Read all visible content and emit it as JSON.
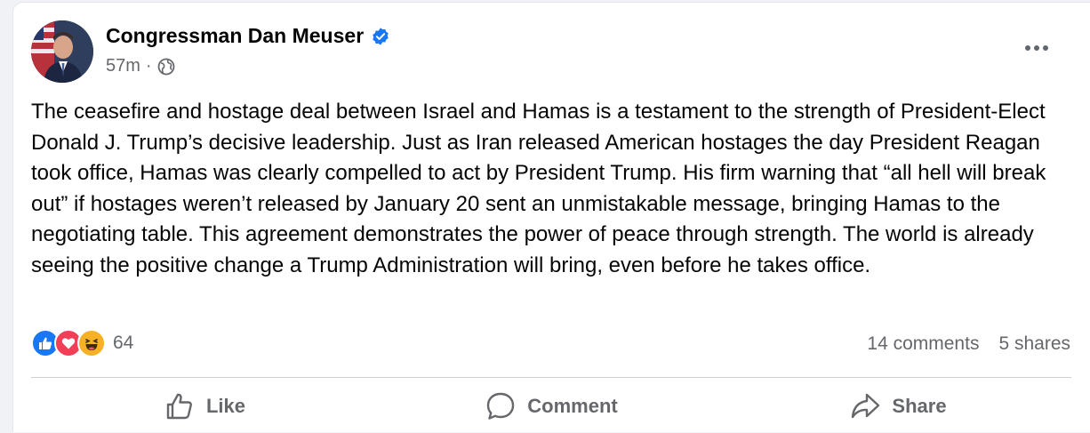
{
  "post": {
    "author": "Congressman Dan Meuser",
    "time": "57m",
    "separator": "·",
    "audience_icon": "globe-icon",
    "verified_icon": "verified-badge-icon",
    "text": "The ceasefire and hostage deal between Israel and Hamas is a testament to the strength of President-Elect Donald J. Trump’s decisive leadership. Just as Iran released American hostages the day President Reagan took office, Hamas was clearly compelled to act by President Trump. His firm warning that “all hell will break out” if hostages weren’t released by January 20 sent an unmistakable message, bringing Hamas to the negotiating table. This agreement demonstrates the power of peace through strength. The world is already seeing the positive change a Trump Administration will bring, even before he takes office."
  },
  "reactions": {
    "icons": [
      "like-icon",
      "love-icon",
      "haha-icon"
    ],
    "count": "64"
  },
  "stats": {
    "comments": "14 comments",
    "shares": "5 shares"
  },
  "actions": {
    "like": "Like",
    "comment": "Comment",
    "share": "Share"
  },
  "colors": {
    "accent": "#1877f2",
    "love": "#f33e58",
    "haha": "#f7b125",
    "muted_text": "#65676b"
  }
}
